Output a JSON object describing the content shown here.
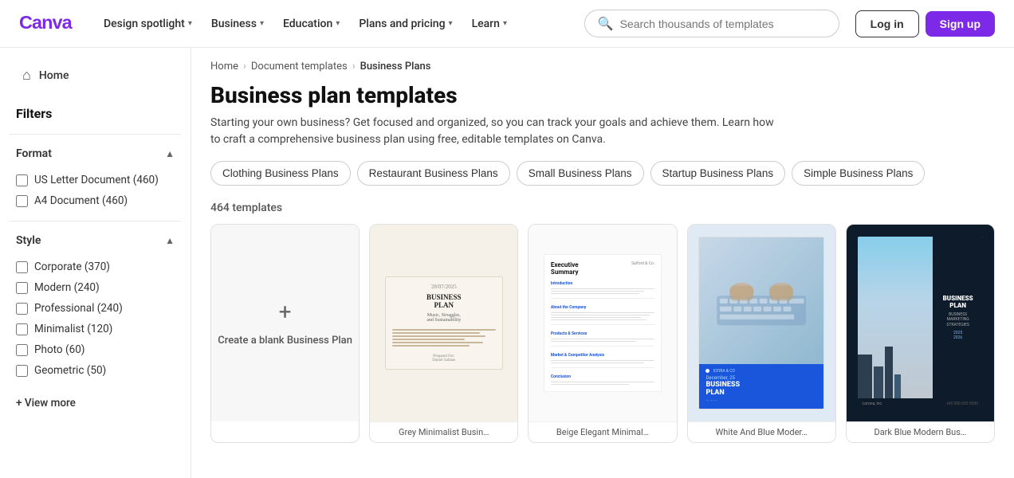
{
  "brand": {
    "name": "Canva",
    "logo_color": "#7d2ae8"
  },
  "navbar": {
    "nav_items": [
      {
        "label": "Design spotlight",
        "has_chevron": true
      },
      {
        "label": "Business",
        "has_chevron": true
      },
      {
        "label": "Education",
        "has_chevron": true
      },
      {
        "label": "Plans and pricing",
        "has_chevron": true
      },
      {
        "label": "Learn",
        "has_chevron": true
      }
    ],
    "search_placeholder": "Search thousands of templates",
    "login_label": "Log in",
    "signup_label": "Sign up"
  },
  "sidebar": {
    "home_label": "Home",
    "filters_label": "Filters",
    "format_section": {
      "label": "Format",
      "options": [
        {
          "label": "US Letter Document (460)",
          "checked": false
        },
        {
          "label": "A4 Document (460)",
          "checked": false
        }
      ]
    },
    "style_section": {
      "label": "Style",
      "options": [
        {
          "label": "Corporate (370)",
          "checked": false
        },
        {
          "label": "Modern (240)",
          "checked": false
        },
        {
          "label": "Professional (240)",
          "checked": false
        },
        {
          "label": "Minimalist (120)",
          "checked": false
        },
        {
          "label": "Photo (60)",
          "checked": false
        },
        {
          "label": "Geometric (50)",
          "checked": false
        }
      ]
    },
    "view_more_label": "+ View more"
  },
  "content": {
    "breadcrumbs": [
      {
        "label": "Home",
        "link": true
      },
      {
        "label": "Document templates",
        "link": true
      },
      {
        "label": "Business Plans",
        "link": false
      }
    ],
    "page_title": "Business plan templates",
    "page_description": "Starting your own business? Get focused and organized, so you can track your goals and achieve them. Learn how to craft a comprehensive business plan using free, editable templates on Canva.",
    "tags": [
      "Clothing Business Plans",
      "Restaurant Business Plans",
      "Small Business Plans",
      "Startup Business Plans",
      "Simple Business Plans"
    ],
    "templates_count": "464 templates",
    "blank_card": {
      "label": "Create a blank Business Plan"
    },
    "template_cards": [
      {
        "id": "card-2",
        "label": "Grey Minimalist Busin…",
        "style": "beige"
      },
      {
        "id": "card-3",
        "label": "Beige Elegant Minimal…",
        "style": "white"
      },
      {
        "id": "card-4",
        "label": "White And Blue Moder…",
        "style": "blue"
      },
      {
        "id": "card-5",
        "label": "Dark Blue Modern Bus…",
        "style": "dark"
      }
    ]
  }
}
